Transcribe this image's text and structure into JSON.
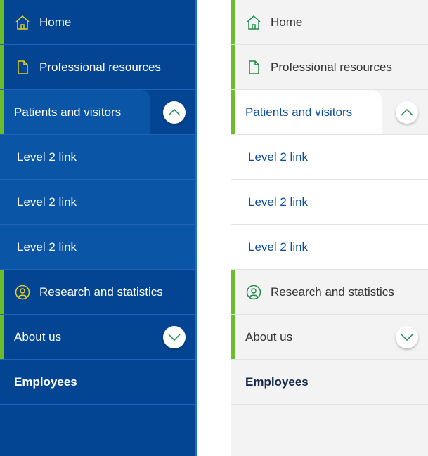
{
  "menus": {
    "home": "Home",
    "professional": "Professional resources",
    "patients": "Patients and visitors",
    "level2": [
      "Level 2 link",
      "Level 2 link",
      "Level 2 link"
    ],
    "research": "Research and statistics",
    "about": "About us",
    "employees": "Employees"
  },
  "colors": {
    "blue_bg": "#034592",
    "light_bg": "#f3f3f3",
    "accent_green": "#6cbd2b",
    "icon_yellow": "#e8d21d",
    "icon_green": "#1f8a4c",
    "link_blue": "#0a4d9c"
  },
  "icons": {
    "home": "home-icon",
    "professional": "document-icon",
    "research": "user-circle-icon",
    "expand_open": "chevron-up-icon",
    "expand_closed": "chevron-down-icon"
  }
}
